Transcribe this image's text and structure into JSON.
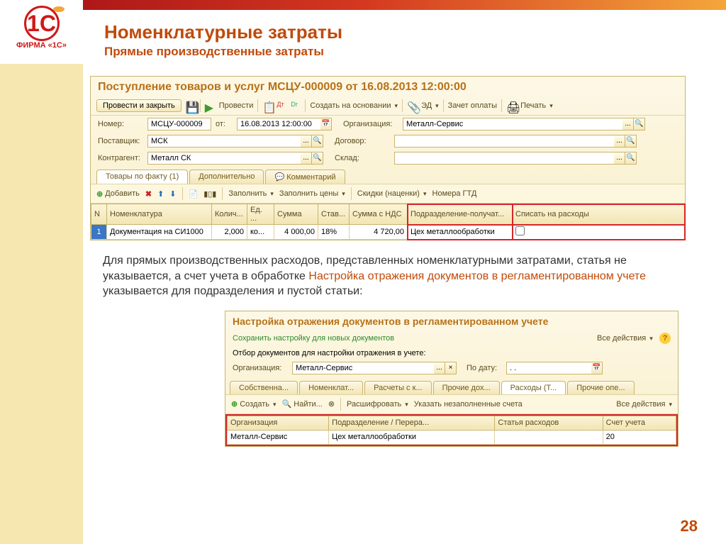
{
  "brand": {
    "logo": "1C",
    "caption": "ФИРМА «1С»"
  },
  "heading": {
    "title": "Номенклатурные затраты",
    "subtitle": "Прямые производственные затраты"
  },
  "doc": {
    "title": "Поступление товаров и услуг МСЦУ-000009 от 16.08.2013 12:00:00",
    "btn_post_close": "Провести и закрыть",
    "btn_post": "Провести",
    "btn_create_based": "Создать на основании",
    "btn_ed": "ЭД",
    "btn_offset": "Зачет оплаты",
    "btn_print": "Печать",
    "lbl_number": "Номер:",
    "number": "МСЦУ-000009",
    "lbl_from": "от:",
    "date": "16.08.2013 12:00:00",
    "lbl_org": "Организация:",
    "org": "Металл-Сервис",
    "lbl_supplier": "Поставщик:",
    "supplier": "МСК",
    "lbl_contract": "Договор:",
    "contract": "",
    "lbl_counterparty": "Контрагент:",
    "counterparty": "Металл СК",
    "lbl_warehouse": "Склад:",
    "warehouse": "",
    "tabs": [
      "Товары по факту (1)",
      "Дополнительно",
      "Комментарий"
    ],
    "sub": {
      "add": "Добавить",
      "fill": "Заполнить",
      "fill_prices": "Заполнить цены",
      "discounts": "Скидки (наценки)",
      "gtd": "Номера ГТД"
    },
    "cols": [
      "N",
      "Номенклатура",
      "Колич...",
      "Ед. ...",
      "Сумма",
      "Став...",
      "Сумма с НДС",
      "Подразделение-получат...",
      "Списать на расходы"
    ],
    "row": {
      "n": "1",
      "nom": "Документация на СИ1000",
      "qty": "2,000",
      "unit": "ко...",
      "sum": "4 000,00",
      "vat": "18%",
      "sum_vat": "4 720,00",
      "dept": "Цех металлообработки",
      "write": ""
    }
  },
  "para": {
    "t1": "Для прямых производственных расходов, представленных номенклатурными затратами, статья не указывается, а счет учета в обработке ",
    "em": "Настройка отражения документов в регламентированном учете",
    "t2": " указывается для подразделения и пустой статьи:"
  },
  "cfg": {
    "title": "Настройка отражения документов в регламентированном учете",
    "save_link": "Сохранить настройку для новых документов",
    "all_actions": "Все действия",
    "filter_label": "Отбор документов для настройки отражения в учете:",
    "lbl_org": "Организация:",
    "org": "Металл-Сервис",
    "lbl_todate": "По дату:",
    "todate": ". .",
    "tabs": [
      "Собственна...",
      "Номенклат...",
      "Расчеты с к...",
      "Прочие дох...",
      "Расходы (Т...",
      "Прочие опе..."
    ],
    "btn_create": "Создать",
    "btn_find": "Найти...",
    "btn_decode": "Расшифровать",
    "btn_unfilled": "Указать незаполненные счета",
    "cols": [
      "Организация",
      "Подразделение / Перера...",
      "Статья расходов",
      "Счет учета"
    ],
    "row": {
      "org": "Металл-Сервис",
      "dept": "Цех металлообработки",
      "article": "",
      "acct": "20"
    }
  },
  "page": "28"
}
